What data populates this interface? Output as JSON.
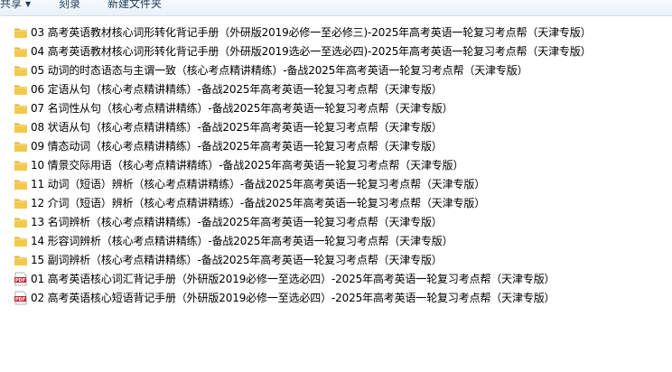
{
  "toolbar": {
    "share_label": "共享",
    "burn_label": "刻录",
    "new_folder_label": "新建文件夹"
  },
  "colors": {
    "folder_fill": "#f2c94c",
    "folder_tab": "#e2b23a",
    "pdf_red": "#c0202a"
  },
  "files": [
    {
      "type": "folder",
      "icon": "folder-icon",
      "name": "03 高考英语教材核心词形转化背记手册（外研版2019必修一至必修三)-2025年高考英语一轮复习考点帮（天津专版）"
    },
    {
      "type": "folder",
      "icon": "folder-icon",
      "name": "04 高考英语教材核心词形转化背记手册（外研版2019选必一至选必四)-2025年高考英语一轮复习考点帮（天津专版）"
    },
    {
      "type": "folder",
      "icon": "folder-icon",
      "name": "05 动词的时态语态与主谓一致（核心考点精讲精练）-备战2025年高考英语一轮复习考点帮（天津专版）"
    },
    {
      "type": "folder",
      "icon": "folder-icon",
      "name": "06 定语从句（核心考点精讲精练）-备战2025年高考英语一轮复习考点帮（天津专版）"
    },
    {
      "type": "folder",
      "icon": "folder-icon",
      "name": "07 名词性从句（核心考点精讲精练）-备战2025年高考英语一轮复习考点帮（天津专版）"
    },
    {
      "type": "folder",
      "icon": "folder-icon",
      "name": "08 状语从句（核心考点精讲精练）-备战2025年高考英语一轮复习考点帮（天津专版）"
    },
    {
      "type": "folder",
      "icon": "folder-icon",
      "name": "09 情态动词（核心考点精讲精练）-备战2025年高考英语一轮复习考点帮（天津专版）"
    },
    {
      "type": "folder",
      "icon": "folder-icon",
      "name": "10 情景交际用语（核心考点精讲精练）-备战2025年高考英语一轮复习考点帮（天津专版）"
    },
    {
      "type": "folder",
      "icon": "folder-icon",
      "name": "11 动词（短语）辨析（核心考点精讲精练）-备战2025年高考英语一轮复习考点帮（天津专版）"
    },
    {
      "type": "folder",
      "icon": "folder-icon",
      "name": "12 介词（短语）辨析（核心考点精讲精练）-备战2025年高考英语一轮复习考点帮（天津专版）"
    },
    {
      "type": "folder",
      "icon": "folder-icon",
      "name": "13 名词辨析（核心考点精讲精练）-备战2025年高考英语一轮复习考点帮（天津专版）"
    },
    {
      "type": "folder",
      "icon": "folder-icon",
      "name": "14 形容词辨析（核心考点精讲精练）-备战2025年高考英语一轮复习考点帮（天津专版）"
    },
    {
      "type": "folder",
      "icon": "folder-icon",
      "name": "15 副词辨析（核心考点精讲精练）-备战2025年高考英语一轮复习考点帮（天津专版）"
    },
    {
      "type": "pdf",
      "icon": "pdf-file-icon",
      "icon_text": "PDF",
      "name": "01 高考英语核心词汇背记手册（外研版2019必修一至选必四）-2025年高考英语一轮复习考点帮（天津专版）"
    },
    {
      "type": "pdf",
      "icon": "pdf-file-icon",
      "icon_text": "PDF",
      "name": "02 高考英语核心短语背记手册（外研版2019必修一至选必四）-2025年高考英语一轮复习考点帮（天津专版）"
    }
  ]
}
